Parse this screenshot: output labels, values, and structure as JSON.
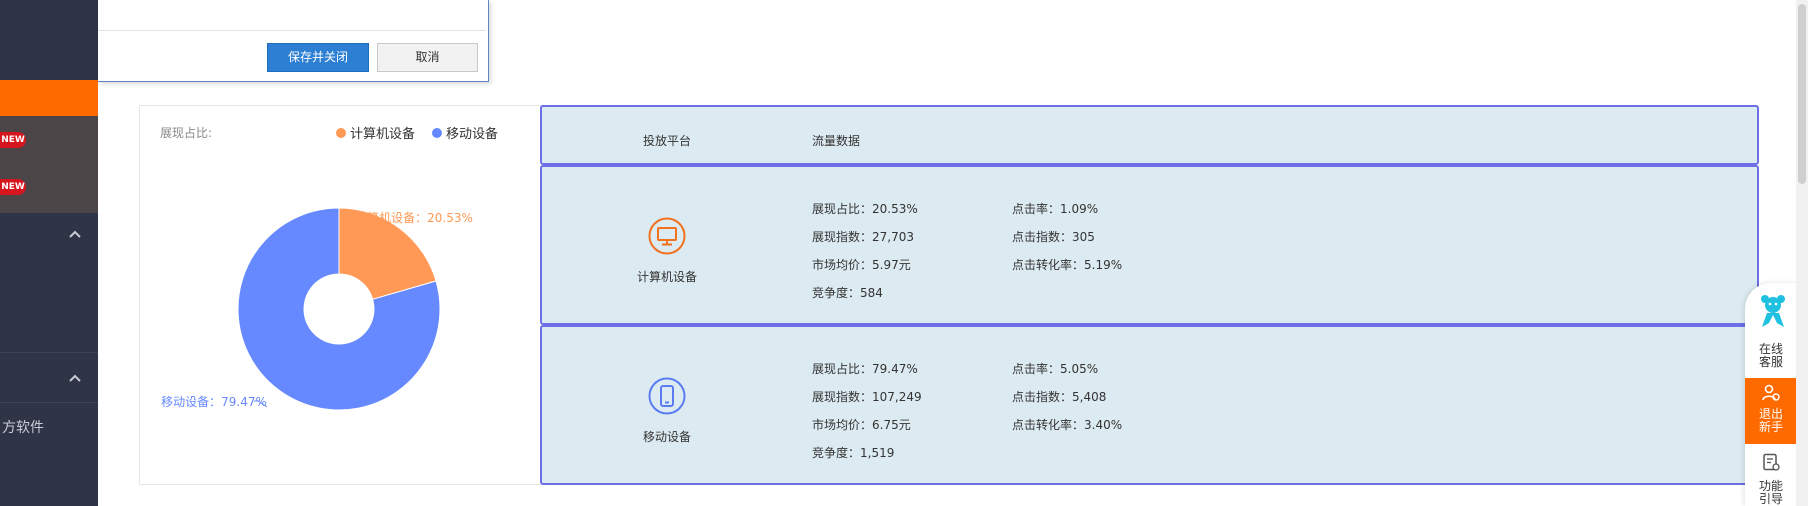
{
  "dialog": {
    "save_label": "保存并关闭",
    "cancel_label": "取消"
  },
  "sidebar": {
    "badges": [
      "NEW",
      "NEW"
    ],
    "partial_text": "方软件"
  },
  "chart_panel": {
    "share_label": "展现占比:",
    "legend": [
      {
        "name": "计算机设备",
        "color": "#ff9955"
      },
      {
        "name": "移动设备",
        "color": "#6689ff"
      }
    ],
    "callouts": {
      "computer": "计算机设备：20.53%",
      "mobile": "移动设备：79.47%"
    }
  },
  "chart_data": {
    "type": "pie",
    "donut": true,
    "categories": [
      "计算机设备",
      "移动设备"
    ],
    "values": [
      20.53,
      79.47
    ],
    "unit": "%",
    "colors": [
      "#ff9955",
      "#6689ff"
    ],
    "title": "展现占比:",
    "legend_position": "top-right"
  },
  "table": {
    "header": {
      "platform": "投放平台",
      "traffic": "流量数据"
    },
    "rows": [
      {
        "name": "计算机设备",
        "icon": "monitor-icon",
        "color": "#f2711c",
        "left": [
          "展现占比：20.53%",
          "展现指数：27,703",
          "市场均价：5.97元",
          "竞争度：584"
        ],
        "right": [
          "点击率：1.09%",
          "点击指数：305",
          "点击转化率：5.19%"
        ]
      },
      {
        "name": "移动设备",
        "icon": "mobile-phone-icon",
        "color": "#5b7cf0",
        "left": [
          "展现占比：79.47%",
          "展现指数：107,249",
          "市场均价：6.75元",
          "竞争度：1,519"
        ],
        "right": [
          "点击率：5.05%",
          "点击指数：5,408",
          "点击转化率：3.40%"
        ]
      }
    ]
  },
  "float_bar": {
    "online_service": [
      "在线",
      "客服"
    ],
    "exit_newbie": [
      "退出",
      "新手"
    ],
    "feature_guide": [
      "功能",
      "引导"
    ]
  }
}
